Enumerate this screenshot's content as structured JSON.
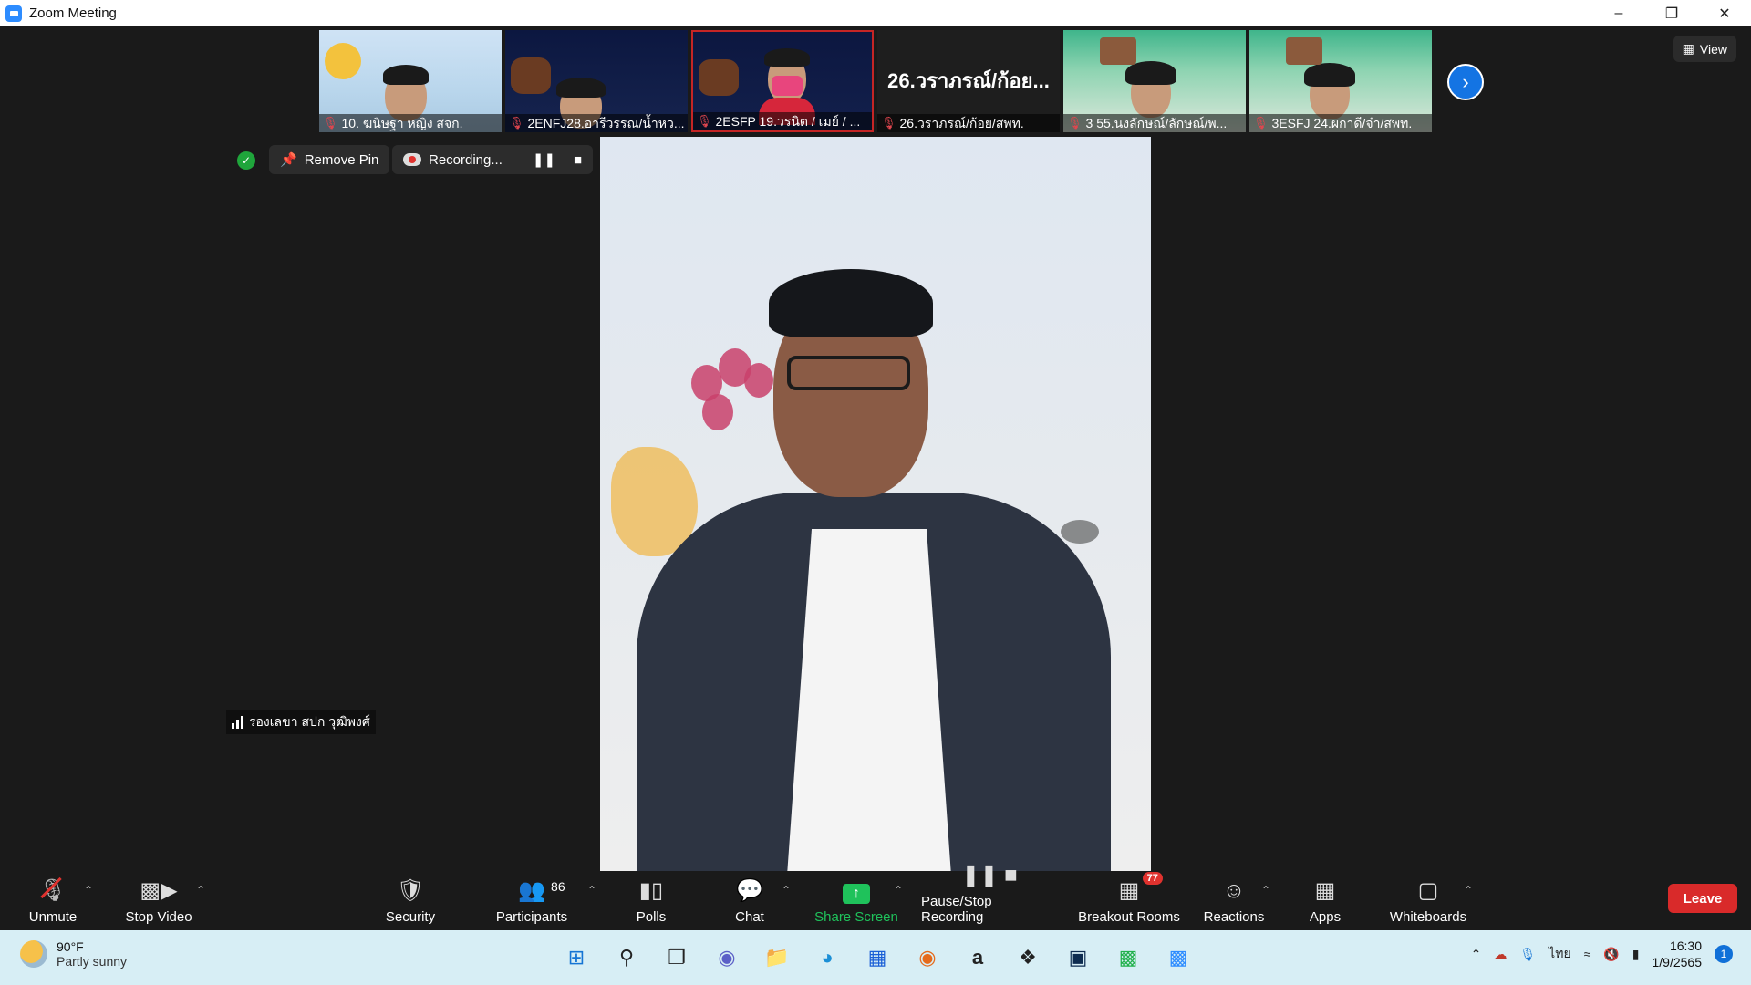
{
  "window": {
    "title": "Zoom Meeting"
  },
  "thumbnails": [
    {
      "name": "10. ฆนิษฐา หญิง สจก.",
      "muted": true
    },
    {
      "name": "2ENFJ28.อารีวรรณ/น้ำหว...",
      "muted": true
    },
    {
      "name": "2ESFP 19.วรนิต / เมย์ / ...",
      "muted": true
    },
    {
      "name": "26.วราภรณ์/ก้อย/สพท.",
      "muted": true,
      "display_text": "26.วราภรณ์/ก้อย..."
    },
    {
      "name": "3 55.นงลักษณ์/ลักษณ์/พ...",
      "muted": true
    },
    {
      "name": "3ESFJ 24.ผกาดี/จ๋า/สพท.",
      "muted": true
    }
  ],
  "view_button": {
    "label": "View"
  },
  "pin": {
    "label": "Remove Pin"
  },
  "recording": {
    "label": "Recording..."
  },
  "speaker": {
    "name": "รองเลขา สปก วุฒิพงศ์"
  },
  "toolbar": {
    "unmute": "Unmute",
    "stop_video": "Stop Video",
    "security": "Security",
    "participants": "Participants",
    "participants_count": "86",
    "polls": "Polls",
    "chat": "Chat",
    "share_screen": "Share Screen",
    "pause_stop_recording": "Pause/Stop Recording",
    "breakout_rooms": "Breakout Rooms",
    "breakout_badge": "77",
    "reactions": "Reactions",
    "apps": "Apps",
    "whiteboards": "Whiteboards",
    "leave": "Leave"
  },
  "taskbar": {
    "weather_temp": "90°F",
    "weather_desc": "Partly sunny",
    "language": "ไทย",
    "time": "16:30",
    "date": "1/9/2565",
    "notifications": "1"
  },
  "colors": {
    "accent": "#2D8CFF",
    "leave": "#D92A2A",
    "share": "#1FC25B",
    "badge": "#E0322E"
  }
}
